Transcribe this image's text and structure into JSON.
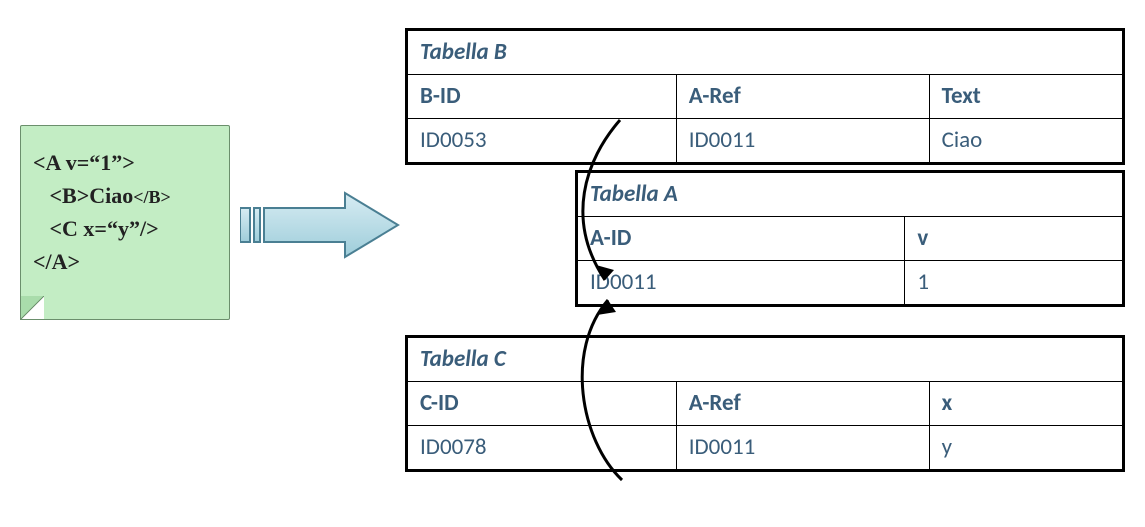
{
  "note": {
    "line1": "<A v=“1”>",
    "line2_open": "   <B>",
    "line2_text": "Ciao",
    "line2_close": "</B>",
    "line3": "   <C x=“y”/>",
    "line4": "</A>"
  },
  "tables": {
    "B": {
      "title": "Tabella B",
      "headers": [
        "B-ID",
        "A-Ref",
        "Text"
      ],
      "row": [
        "ID0053",
        "ID0011",
        "Ciao"
      ]
    },
    "A": {
      "title": "Tabella A",
      "headers": [
        "A-ID",
        "v"
      ],
      "row": [
        "ID0011",
        "1"
      ]
    },
    "C": {
      "title": "Tabella C",
      "headers": [
        "C-ID",
        "A-Ref",
        "x"
      ],
      "row": [
        "ID0078",
        "ID0011",
        "y"
      ]
    }
  }
}
